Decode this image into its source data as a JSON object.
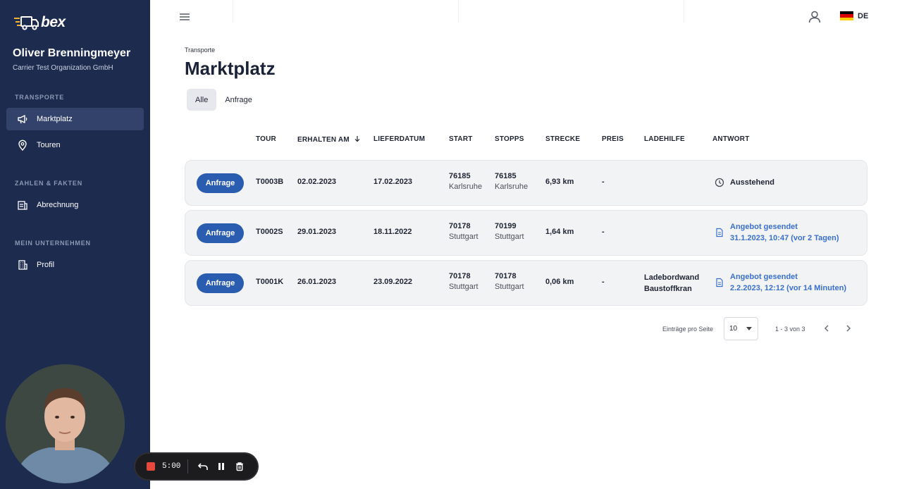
{
  "brand": {
    "name": "bex"
  },
  "user": {
    "name": "Oliver Brenningmeyer",
    "org": "Carrier Test Organization GmbH"
  },
  "sidebar": {
    "sections": [
      {
        "title": "TRANSPORTE"
      },
      {
        "title": "ZAHLEN & FAKTEN"
      },
      {
        "title": "MEIN UNTERNEHMEN"
      }
    ],
    "items": [
      {
        "label": "Marktplatz",
        "icon": "megaphone-icon",
        "active": true
      },
      {
        "label": "Touren",
        "icon": "location-pin-icon",
        "active": false
      },
      {
        "label": "Abrechnung",
        "icon": "invoice-icon",
        "active": false
      },
      {
        "label": "Profil",
        "icon": "building-icon",
        "active": false
      }
    ]
  },
  "topbar": {
    "language": "DE"
  },
  "page": {
    "breadcrumb": "Transporte",
    "title": "Marktplatz"
  },
  "tabs": [
    {
      "label": "Alle",
      "active": true
    },
    {
      "label": "Anfrage",
      "active": false
    }
  ],
  "table": {
    "headers": {
      "tour": "TOUR",
      "received": "ERHALTEN AM",
      "delivery": "LIEFERDATUM",
      "start": "START",
      "stops": "STOPPS",
      "distance": "STRECKE",
      "price": "PREIS",
      "loading": "LADEHILFE",
      "answer": "ANTWORT"
    },
    "rows": [
      {
        "type": "Anfrage",
        "tour": "T0003B",
        "received": "02.02.2023",
        "delivery": "17.02.2023",
        "start_zip": "76185",
        "start_city": "Karlsruhe",
        "stop_zip": "76185",
        "stop_city": "Karlsruhe",
        "distance": "6,93 km",
        "price": "-",
        "loading1": "",
        "loading2": "",
        "answer1": "Ausstehend",
        "answer2": "",
        "answer_icon": "clock-icon",
        "answer_link": false
      },
      {
        "type": "Anfrage",
        "tour": "T0002S",
        "received": "29.01.2023",
        "delivery": "18.11.2022",
        "start_zip": "70178",
        "start_city": "Stuttgart",
        "stop_zip": "70199",
        "stop_city": "Stuttgart",
        "distance": "1,64 km",
        "price": "-",
        "loading1": "",
        "loading2": "",
        "answer1": "Angebot gesendet",
        "answer2": "31.1.2023, 10:47 (vor 2 Tagen)",
        "answer_icon": "document-icon",
        "answer_link": true
      },
      {
        "type": "Anfrage",
        "tour": "T0001K",
        "received": "26.01.2023",
        "delivery": "23.09.2022",
        "start_zip": "70178",
        "start_city": "Stuttgart",
        "stop_zip": "70178",
        "stop_city": "Stuttgart",
        "distance": "0,06 km",
        "price": "-",
        "loading1": "Ladebordwand",
        "loading2": "Baustoffkran",
        "answer1": "Angebot gesendet",
        "answer2": "2.2.2023, 12:12 (vor 14 Minuten)",
        "answer_icon": "document-icon",
        "answer_link": true
      }
    ]
  },
  "pagination": {
    "label": "Einträge pro Seite",
    "per_page": "10",
    "range": "1 - 3 von 3"
  },
  "recorder": {
    "time": "5:00"
  },
  "colors": {
    "sidebar": "#1d2b4f",
    "primary": "#2a5db0",
    "link": "#3a6fd0",
    "record": "#e5483d"
  }
}
